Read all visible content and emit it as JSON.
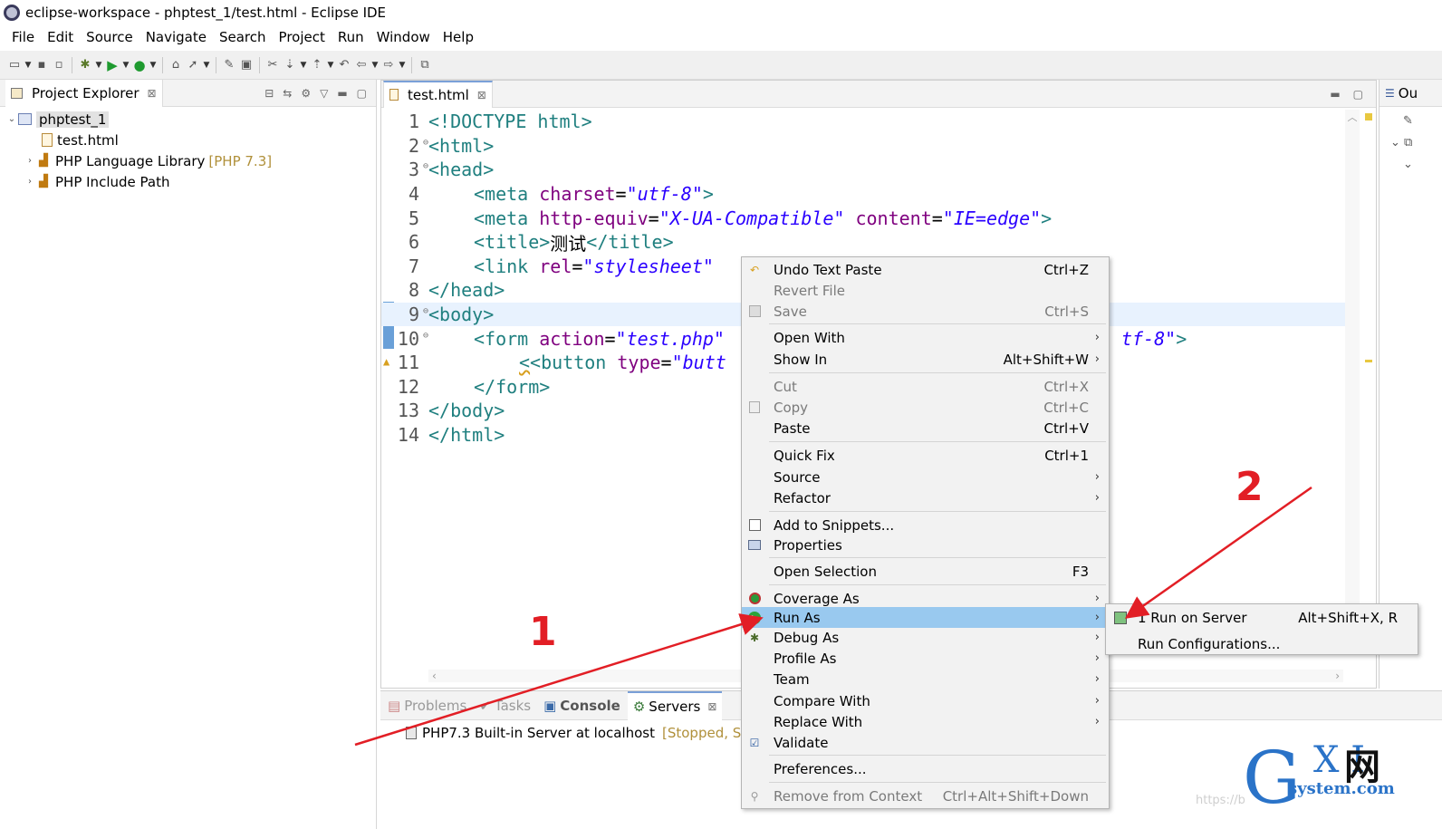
{
  "window": {
    "title": "eclipse-workspace - phptest_1/test.html - Eclipse IDE"
  },
  "menubar": [
    "File",
    "Edit",
    "Source",
    "Navigate",
    "Search",
    "Project",
    "Run",
    "Window",
    "Help"
  ],
  "explorer": {
    "tab_label": "Project Explorer",
    "tree": {
      "project": "phptest_1",
      "file": "test.html",
      "lib_name": "PHP Language Library",
      "lib_version": "[PHP 7.3]",
      "include_path": "PHP Include Path"
    }
  },
  "editor": {
    "tab_label": "test.html",
    "lines": [
      {
        "num": "1"
      },
      {
        "num": "2"
      },
      {
        "num": "3"
      },
      {
        "num": "4"
      },
      {
        "num": "5"
      },
      {
        "num": "6"
      },
      {
        "num": "7"
      },
      {
        "num": "8"
      },
      {
        "num": "9"
      },
      {
        "num": "10"
      },
      {
        "num": "11"
      },
      {
        "num": "12"
      },
      {
        "num": "13"
      },
      {
        "num": "14"
      }
    ],
    "code": {
      "l1": "<!DOCTYPE html>",
      "l2": "<html>",
      "l3": "<head>",
      "l4_tag": "<meta ",
      "l4_attr": "charset",
      "l4_eq": "=",
      "l4_val": "\"utf-8\"",
      "l4_end": ">",
      "l5_tag": "<meta ",
      "l5_attr1": "http-equiv",
      "l5_eq": "=",
      "l5_val1": "\"X-UA-Compatible\"",
      "l5_attr2": " content",
      "l5_val2": "\"IE=edge\"",
      "l5_end": ">",
      "l6_open": "<title>",
      "l6_text": "测试",
      "l6_close": "</title>",
      "l7_tag": "<link ",
      "l7_attr": "rel",
      "l7_eq": "=",
      "l7_val": "\"stylesheet\"",
      "l8": "</head>",
      "l9": "<body>",
      "l10_tag": "<form ",
      "l10_attr": "action",
      "l10_eq": "=",
      "l10_val": "\"test.php\"",
      "l10_tail": "tf-8\"",
      "l10_end": ">",
      "l11_lt": "<",
      "l11_tag": "<button ",
      "l11_attr": "type",
      "l11_eq": "=",
      "l11_val": "\"butt",
      "l12": "</form>",
      "l13": "</body>",
      "l14": "</html>"
    }
  },
  "outline": {
    "tab_label": "Ou"
  },
  "bottom": {
    "tabs": [
      "Problems",
      "Tasks",
      "Console",
      "Servers"
    ],
    "server_name": "PHP7.3 Built-in Server at localhost",
    "server_status": "[Stopped, Syn"
  },
  "context_menu": {
    "items": [
      {
        "label": "Undo Text Paste",
        "accel": "Ctrl+Z"
      },
      {
        "label": "Revert File",
        "accel": ""
      },
      {
        "label": "Save",
        "accel": "Ctrl+S"
      },
      {
        "label": "Open With",
        "accel": ""
      },
      {
        "label": "Show In",
        "accel": "Alt+Shift+W"
      },
      {
        "label": "Cut",
        "accel": "Ctrl+X"
      },
      {
        "label": "Copy",
        "accel": "Ctrl+C"
      },
      {
        "label": "Paste",
        "accel": "Ctrl+V"
      },
      {
        "label": "Quick Fix",
        "accel": "Ctrl+1"
      },
      {
        "label": "Source",
        "accel": ""
      },
      {
        "label": "Refactor",
        "accel": ""
      },
      {
        "label": "Add to Snippets...",
        "accel": ""
      },
      {
        "label": "Properties",
        "accel": ""
      },
      {
        "label": "Open Selection",
        "accel": "F3"
      },
      {
        "label": "Coverage As",
        "accel": ""
      },
      {
        "label": "Run As",
        "accel": ""
      },
      {
        "label": "Debug As",
        "accel": ""
      },
      {
        "label": "Profile As",
        "accel": ""
      },
      {
        "label": "Team",
        "accel": ""
      },
      {
        "label": "Compare With",
        "accel": ""
      },
      {
        "label": "Replace With",
        "accel": ""
      },
      {
        "label": "Validate",
        "accel": ""
      },
      {
        "label": "Preferences...",
        "accel": ""
      },
      {
        "label": "Remove from Context",
        "accel": "Ctrl+Alt+Shift+Down"
      }
    ]
  },
  "submenu": {
    "items": [
      {
        "label": "1 Run on Server",
        "accel": "Alt+Shift+X, R"
      },
      {
        "label": "Run Configurations...",
        "accel": ""
      }
    ]
  },
  "annotations": {
    "one": "1",
    "two": "2",
    "color": "#e21e25"
  },
  "watermark": {
    "g": "G",
    "xi": "X I",
    "cn": "网",
    "sys": "system.com",
    "url": "https://b"
  },
  "colors": {
    "selection": "#99c9ef",
    "tag": "#1f7f7f",
    "attr": "#7f007f",
    "string": "#2a00ff"
  }
}
